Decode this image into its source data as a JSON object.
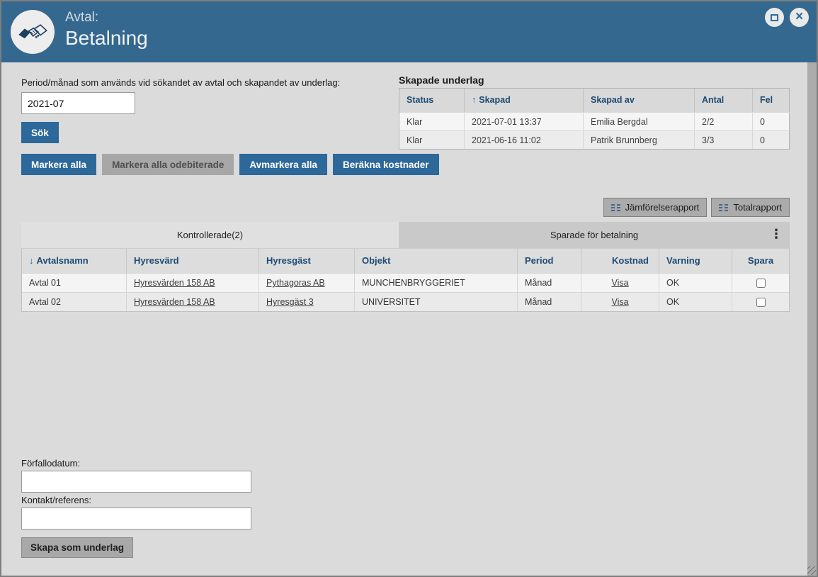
{
  "window": {
    "title_small": "Avtal:",
    "title_large": "Betalning",
    "close_icon": "×"
  },
  "search": {
    "period_label": "Period/månad som används vid sökandet av avtal och skapandet av underlag:",
    "period_value": "2021-07",
    "sok_button": "Sök"
  },
  "actions": {
    "markera_alla": "Markera alla",
    "markera_alla_odebiterade": "Markera alla odebiterade",
    "avmarkera_alla": "Avmarkera alla",
    "berakna_kostnader": "Beräkna kostnader"
  },
  "skapade_underlag": {
    "heading": "Skapade underlag",
    "sort_arrow": "↑",
    "columns": [
      "Status",
      "Skapad",
      "Skapad av",
      "Antal",
      "Fel"
    ],
    "rows": [
      {
        "status": "Klar",
        "skapad": "2021-07-01 13:37",
        "skapad_av": "Emilia Bergdal",
        "antal": "2/2",
        "fel": "0"
      },
      {
        "status": "Klar",
        "skapad": "2021-06-16 11:02",
        "skapad_av": "Patrik Brunnberg",
        "antal": "3/3",
        "fel": "0"
      }
    ]
  },
  "reports": {
    "jamforelserapport": "Jämförelserapport",
    "totalrapport": "Totalrapport"
  },
  "tabs": {
    "active_label": "Kontrollerade(2)",
    "inactive_label": "Sparade för betalning",
    "menu_icon": "⋮"
  },
  "contracts_table": {
    "sort_arrow": "↓",
    "columns": [
      "Avtalsnamn",
      "Hyresvärd",
      "Hyresgäst",
      "Objekt",
      "Period",
      "Kostnad",
      "Varning",
      "Spara"
    ],
    "rows": [
      {
        "avtalsnamn": "Avtal 01",
        "hyresvard": "Hyresvärden 158 AB",
        "hyresgast": "Pythagoras AB",
        "objekt": "MUNCHENBRYGGERIET",
        "period": "Månad",
        "kostnad": "Visa",
        "varning": "OK"
      },
      {
        "avtalsnamn": "Avtal 02",
        "hyresvard": "Hyresvärden 158 AB",
        "hyresgast": "Hyresgäst 3",
        "objekt": "UNIVERSITET",
        "period": "Månad",
        "kostnad": "Visa",
        "varning": "OK"
      }
    ]
  },
  "footer_form": {
    "forfallodatum_label": "Förfallodatum:",
    "forfallodatum_value": "",
    "kontakt_label": "Kontakt/referens:",
    "kontakt_value": "",
    "skapa_button": "Skapa som underlag"
  },
  "colors": {
    "header_blue": "#35688f",
    "button_blue": "#2d689b",
    "ok_green": "#2e7d32",
    "disabled_gray": "#a7a7a7"
  }
}
